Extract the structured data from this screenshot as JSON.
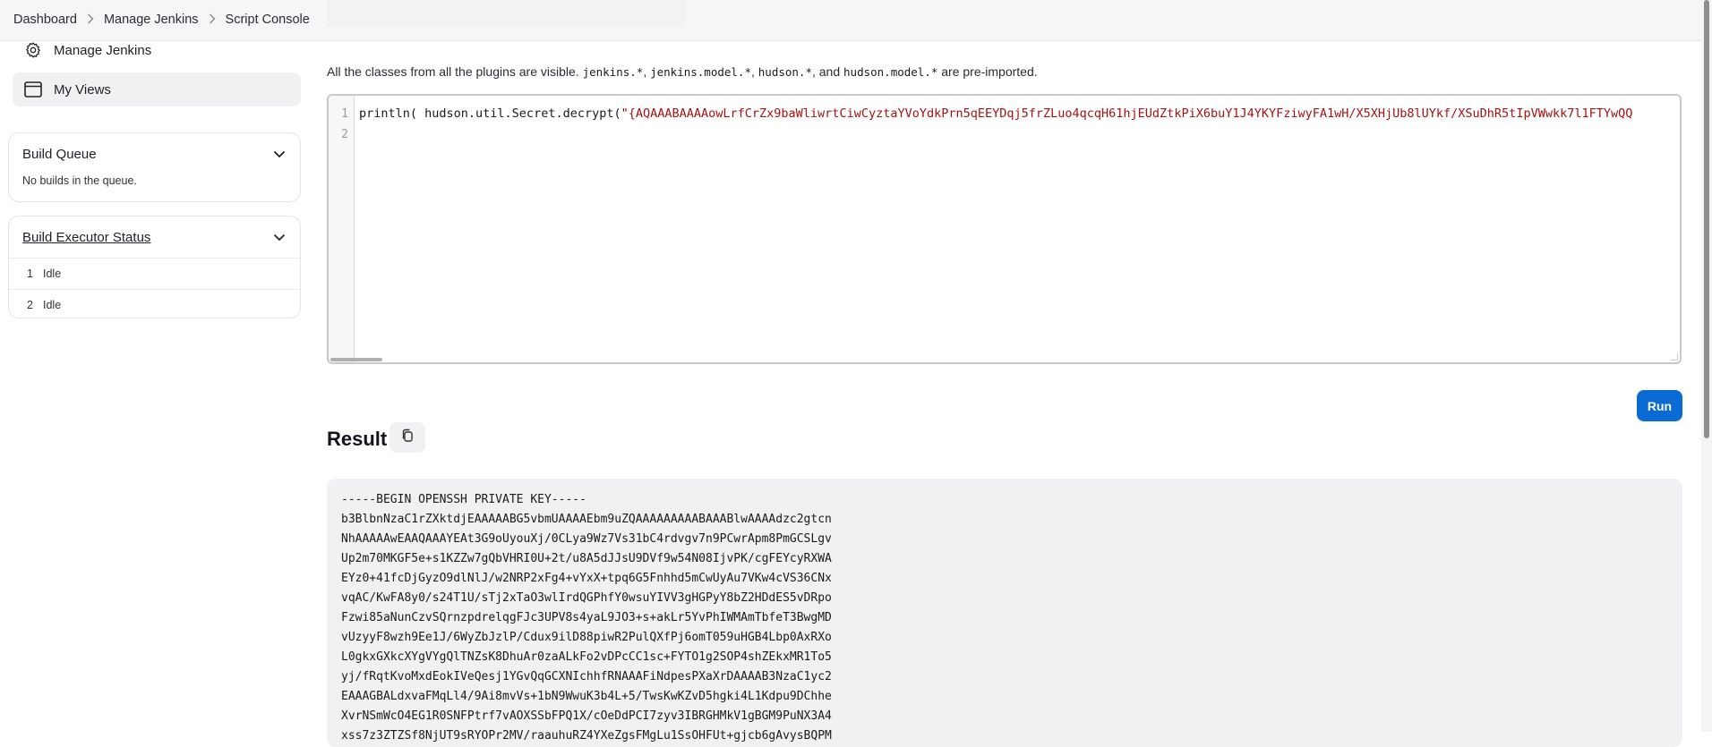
{
  "breadcrumb": {
    "items": [
      "Dashboard",
      "Manage Jenkins",
      "Script Console"
    ],
    "separator": ">"
  },
  "sidebar": {
    "tasks": [
      {
        "label": "Manage Jenkins",
        "icon": "gear-icon"
      },
      {
        "label": "My Views",
        "icon": "window-icon"
      }
    ],
    "build_queue": {
      "title": "Build Queue",
      "empty_text": "No builds in the queue."
    },
    "executor_status": {
      "title": "Build Executor Status",
      "executors": [
        {
          "number": "1",
          "status": "Idle"
        },
        {
          "number": "2",
          "status": "Idle"
        }
      ]
    }
  },
  "console": {
    "intro_prefix": "All the classes from all the plugins are visible.",
    "imports": [
      "jenkins.*",
      "jenkins.model.*",
      "hudson.*",
      "hudson.model.*"
    ],
    "intro_sep_1": ", ",
    "intro_sep_2": ", ",
    "intro_and": ", and ",
    "intro_suffix": " are pre-imported.",
    "line_numbers": [
      "1",
      "2"
    ],
    "code_prefix": "println( hudson.util.Secret.decrypt(",
    "code_string": "\"{AQAAABAAAAowLrfCrZx9baWliwrtCiwCyztaYVoYdkPrn5qEEYDqj5frZLuo4qcqH61hjEUdZtkPiX6buY1J4YKYFziwyFA1wH/X5XHjUb8lUYkf/XSuDhR5tIpVWwkk7l1FTYwQQ",
    "run_label": "Run"
  },
  "result": {
    "title": "Result",
    "lines": [
      "-----BEGIN OPENSSH PRIVATE KEY-----",
      "b3BlbnNzaC1rZXktdjEAAAAABG5vbmUAAAAEbm9uZQAAAAAAAAABAAABlwAAAAdzc2gtcn",
      "NhAAAAAwEAAQAAAYEAt3G9oUyouXj/0CLya9Wz7Vs31bC4rdvgv7n9PCwrApm8PmGCSLgv",
      "Up2m70MKGF5e+s1KZZw7gQbVHRI0U+2t/u8A5dJJsU9DVf9w54N08IjvPK/cgFEYcyRXWA",
      "EYz0+41fcDjGyzO9dlNlJ/w2NRP2xFg4+vYxX+tpq6G5Fnhhd5mCwUyAu7VKw4cVS36CNx",
      "vqAC/KwFA8y0/s24T1U/sTj2xTaO3wlIrdQGPhfY0wsuYIVV3gHGPyY8bZ2HDdES5vDRpo",
      "Fzwi85aNunCzvSQrnzpdrelqgFJc3UPV8s4yaL9JO3+s+akLr5YvPhIWMAmTbfeT3BwgMD",
      "vUzyyF8wzh9Ee1J/6WyZbJzlP/Cdux9ilD88piwR2PulQXfPj6omT059uHGB4Lbp0AxRXo",
      "L0gkxGXkcXYgVYgQlTNZsK8DhuAr0zaALkFo2vDPcCC1sc+FYTO1g2SOP4shZEkxMR1To5",
      "yj/fRqtKvoMxdEokIVeQesj1YGvQqGCXNIchhfRNAAAFiNdpesPXaXrDAAAAB3NzaC1yc2",
      "EAAAGBALdxvaFMqLl4/9Ai8mvVs+1bN9WwuK3b4L+5/TwsKwKZvD5hgki4L1Kdpu9DChhe",
      "XvrNSmWcO4EG1R0SNFPtrf7vAOXSSbFPQ1X/cOeDdPCI7zyv3IBRGHMkV1gBGM9PuNX3A4",
      "xss7z3ZTZSf8NjUT9sRYOPr2MV/raauhuRZ4YXeZgsFMgLu1SsOHFUt+gjcb6gAvysBQPM"
    ]
  },
  "colors": {
    "accent": "#0b6bd4",
    "string_literal": "#aa1111",
    "result_background": "#f1f1f3"
  }
}
